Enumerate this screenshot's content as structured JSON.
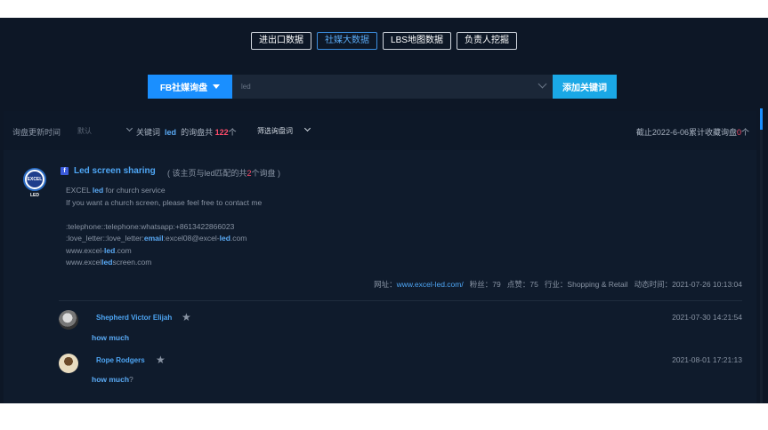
{
  "tabs": [
    {
      "label": "进出口数据",
      "active": false
    },
    {
      "label": "社媒大数据",
      "active": true
    },
    {
      "label": "LBS地图数据",
      "active": false
    },
    {
      "label": "负责人挖掘",
      "active": false
    }
  ],
  "search": {
    "source_select": "FB社媒询盘",
    "keyword_value": "led",
    "add_button": "添加关键词"
  },
  "filter": {
    "update_time_label": "询盘更新时间",
    "update_time_value": "默认",
    "keyword_prefix": "关键词",
    "keyword": "led",
    "count_prefix": "的询盘共",
    "count": "122",
    "count_suffix": "个",
    "filter_button": "筛选询盘词",
    "total_prefix": "截止2022-6-06累计收藏询盘",
    "total_count": "0",
    "total_suffix": "个"
  },
  "post": {
    "avatar_text": "EXCEL LED",
    "platform_icon": "facebook-icon",
    "title": "Led screen sharing",
    "sub_prefix": "( 该主页与led匹配的共",
    "sub_count": "2",
    "sub_suffix": "个询盘 )",
    "body": {
      "line1_a": "EXCEL ",
      "line1_hl": "led",
      "line1_b": " for church service",
      "line2": "If you want a church screen, please feel free to contact me",
      "line3": ":telephone::telephone:whatsapp:+8613422866023",
      "line4_a": ":love_letter::love_letter:",
      "line4_hl1": "email",
      "line4_b": ":excel08@excel-",
      "line4_hl2": "led",
      "line4_c": ".com",
      "line5_a": "www.excel-",
      "line5_hl": "led",
      "line5_b": ".com",
      "line6_a": "www.excel",
      "line6_hl": "led",
      "line6_b": "screen.com"
    },
    "meta": {
      "url_label": "网址：",
      "url": "www.excel-led.com/",
      "fans": "粉丝：79",
      "likes": "点赞：75",
      "industry": "行业：Shopping & Retail",
      "time": "动态时间：2021-07-26 10:13:04"
    }
  },
  "comments": [
    {
      "name": "Shepherd Victor Elijah",
      "time": "2021-07-30 14:21:54",
      "text_hl": "how much",
      "text_rest": ""
    },
    {
      "name": "Rope Rodgers",
      "time": "2021-08-01 17:21:13",
      "text_hl": "how much",
      "text_rest": "?"
    }
  ]
}
